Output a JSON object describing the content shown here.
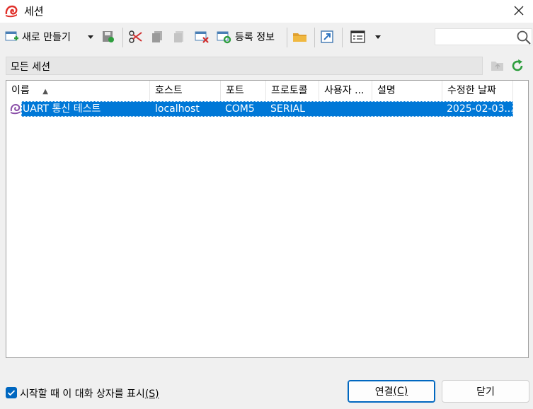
{
  "window": {
    "title": "세션"
  },
  "toolbar": {
    "new_label": "새로 만들기",
    "properties_label": "등록 정보"
  },
  "search": {
    "placeholder": "",
    "value": ""
  },
  "path": {
    "label": "모든 세션"
  },
  "table": {
    "columns": [
      "이름",
      "호스트",
      "포트",
      "프로토콜",
      "사용자 ...",
      "설명",
      "수정한 날짜"
    ],
    "sort_indicator": "▲",
    "rows": [
      {
        "name": "UART 통신 테스트",
        "host": "localhost",
        "port": "COM5",
        "protocol": "SERIAL",
        "user": "",
        "description": "",
        "modified": "2025-02-03..."
      }
    ]
  },
  "footer": {
    "show_on_startup_label": "시작할 때 이 대화 상자를 표시",
    "show_on_startup_accel": "(S)",
    "show_on_startup_checked": true,
    "connect_label": "연결",
    "connect_accel": "(C)",
    "close_label": "닫기"
  },
  "colors": {
    "accent": "#0078d7",
    "checkbox": "#0067c0",
    "brand": "#e0302a"
  }
}
